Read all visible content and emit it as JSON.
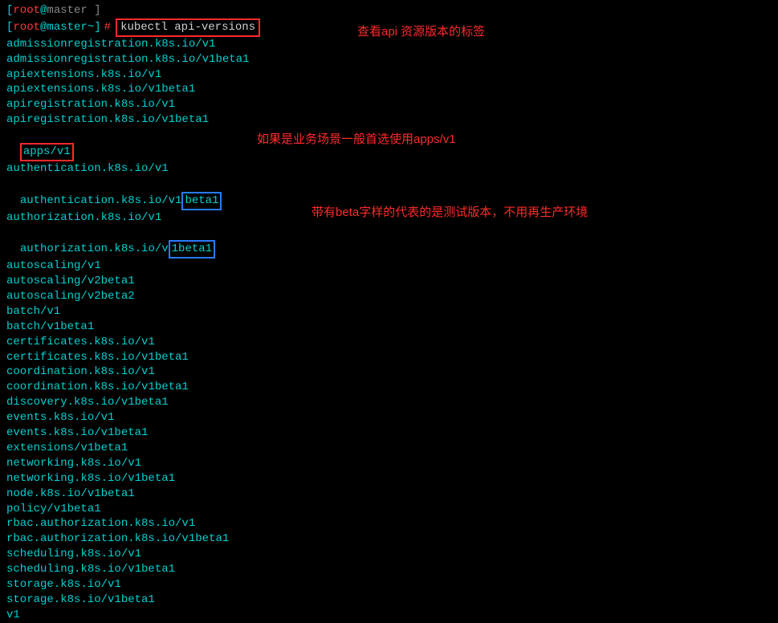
{
  "top_garbled_bracket": "[",
  "top_garbled_red": "root",
  "top_garbled_at": "@",
  "top_garbled_rest": "master  ]",
  "prompt": {
    "open_bracket": "[",
    "user": "root",
    "at": "@",
    "host": "master",
    "cwd": " ~",
    "close_bracket": "]",
    "hash": "#",
    "command": "kubectl api-versions"
  },
  "annotations": {
    "a1": "查看api 资源版本的标签",
    "a2": "如果是业务场景一般首选使用apps/v1",
    "a3": "带有beta字样的代表的是测试版本，不用再生产环境"
  },
  "output": [
    "admissionregistration.k8s.io/v1",
    "admissionregistration.k8s.io/v1beta1",
    "apiextensions.k8s.io/v1",
    "apiextensions.k8s.io/v1beta1",
    "apiregistration.k8s.io/v1",
    "apiregistration.k8s.io/v1beta1"
  ],
  "apps_line": "apps/v1",
  "output2": [
    "authentication.k8s.io/v1"
  ],
  "auth_line_prefix": "authentication.k8s.io/v1",
  "auth_line_beta": "beta1",
  "output3": [
    "authorization.k8s.io/v1"
  ],
  "authz_line_prefix": "authorization.k8s.io/v",
  "authz_line_beta": "1beta1",
  "output4": [
    "autoscaling/v1",
    "autoscaling/v2beta1",
    "autoscaling/v2beta2",
    "batch/v1",
    "batch/v1beta1",
    "certificates.k8s.io/v1",
    "certificates.k8s.io/v1beta1",
    "coordination.k8s.io/v1",
    "coordination.k8s.io/v1beta1",
    "discovery.k8s.io/v1beta1",
    "events.k8s.io/v1",
    "events.k8s.io/v1beta1",
    "extensions/v1beta1",
    "networking.k8s.io/v1",
    "networking.k8s.io/v1beta1",
    "node.k8s.io/v1beta1",
    "policy/v1beta1",
    "rbac.authorization.k8s.io/v1",
    "rbac.authorization.k8s.io/v1beta1",
    "scheduling.k8s.io/v1",
    "scheduling.k8s.io/v1beta1",
    "storage.k8s.io/v1",
    "storage.k8s.io/v1beta1",
    "v1"
  ]
}
